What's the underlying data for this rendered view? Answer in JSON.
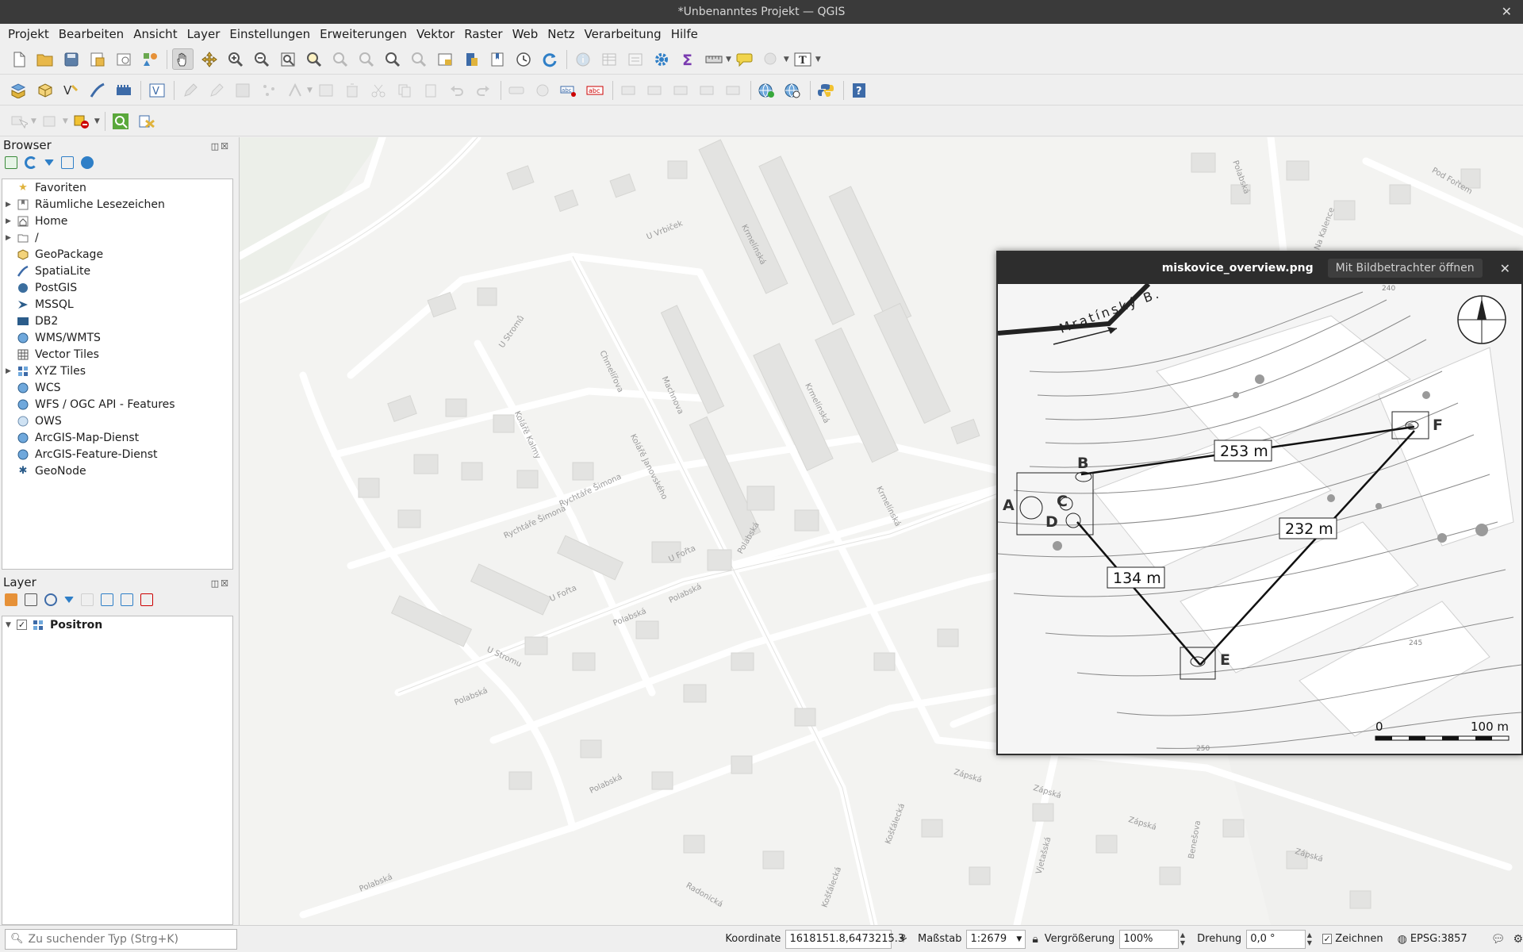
{
  "window": {
    "title": "*Unbenanntes Projekt — QGIS",
    "close_glyph": "✕"
  },
  "menu": [
    "Projekt",
    "Bearbeiten",
    "Ansicht",
    "Layer",
    "Einstellungen",
    "Erweiterungen",
    "Vektor",
    "Raster",
    "Web",
    "Netz",
    "Verarbeitung",
    "Hilfe"
  ],
  "browser_panel": {
    "title": "Browser",
    "items": [
      {
        "label": "Favoriten",
        "icon": "star-icon",
        "expandable": false
      },
      {
        "label": "Räumliche Lesezeichen",
        "icon": "bookmark-icon",
        "expandable": true
      },
      {
        "label": "Home",
        "icon": "home-icon",
        "expandable": true
      },
      {
        "label": "/",
        "icon": "folder-icon",
        "expandable": true
      },
      {
        "label": "GeoPackage",
        "icon": "geopackage-icon",
        "expandable": false
      },
      {
        "label": "SpatiaLite",
        "icon": "spatialite-icon",
        "expandable": false
      },
      {
        "label": "PostGIS",
        "icon": "postgis-icon",
        "expandable": false
      },
      {
        "label": "MSSQL",
        "icon": "mssql-icon",
        "expandable": false
      },
      {
        "label": "DB2",
        "icon": "db2-icon",
        "expandable": false
      },
      {
        "label": "WMS/WMTS",
        "icon": "wms-icon",
        "expandable": false
      },
      {
        "label": "Vector Tiles",
        "icon": "vector-tiles-icon",
        "expandable": false
      },
      {
        "label": "XYZ Tiles",
        "icon": "xyz-tiles-icon",
        "expandable": true
      },
      {
        "label": "WCS",
        "icon": "wcs-icon",
        "expandable": false
      },
      {
        "label": "WFS / OGC API - Features",
        "icon": "wfs-icon",
        "expandable": false
      },
      {
        "label": "OWS",
        "icon": "ows-icon",
        "expandable": false
      },
      {
        "label": "ArcGIS-Map-Dienst",
        "icon": "arcgis-map-icon",
        "expandable": false
      },
      {
        "label": "ArcGIS-Feature-Dienst",
        "icon": "arcgis-feature-icon",
        "expandable": false
      },
      {
        "label": "GeoNode",
        "icon": "geonode-icon",
        "expandable": false
      }
    ]
  },
  "layer_panel": {
    "title": "Layer",
    "layers": [
      {
        "label": "Positron",
        "checked": true,
        "icon": "xyz-tiles-icon"
      }
    ]
  },
  "map": {
    "street_labels": [
      "U Vrbiček",
      "Krmelínská",
      "U Stromů",
      "Chmelířova",
      "Machnova",
      "Kolářě Kalmy",
      "Krmelínská",
      "Krmelínská",
      "Rychtáře Šimona",
      "Rychtáře Šimona",
      "Kolářě Janovského",
      "U Fořta",
      "U Fořta",
      "Polabská",
      "Polabská",
      "U Stromu",
      "Polabská",
      "Polabská",
      "Zápská",
      "Zápská",
      "Zápská",
      "Vjetašská",
      "Košťálecká",
      "Košťálecká",
      "Radonická",
      "Pod Fořtem",
      "Na Kalence",
      "Polabská",
      "Benešova",
      "Polabská",
      "Zápská",
      "Polabská"
    ]
  },
  "image_viewer": {
    "filename": "miskovice_overview.png",
    "open_button": "Mit Bildbetrachter öffnen",
    "close_glyph": "✕",
    "figure": {
      "road_label": "Mratínský B.",
      "points": [
        "A",
        "B",
        "C",
        "D",
        "E",
        "F"
      ],
      "distances": [
        "253 m",
        "232 m",
        "134 m"
      ],
      "contour_labels": [
        "240",
        "245",
        "250"
      ],
      "scale_start": "0",
      "scale_end": "100 m"
    }
  },
  "statusbar": {
    "locator_placeholder": "Zu suchender Typ (Strg+K)",
    "coordinate_label": "Koordinate",
    "coordinate_value": "1618151.8,6473215.3",
    "scale_label": "Maßstab",
    "scale_value": "1:2679",
    "magnification_label": "Vergrößerung",
    "magnification_value": "100%",
    "rotation_label": "Drehung",
    "rotation_value": "0,0 °",
    "render_label": "Zeichnen",
    "render_checked": true,
    "crs": "EPSG:3857"
  }
}
